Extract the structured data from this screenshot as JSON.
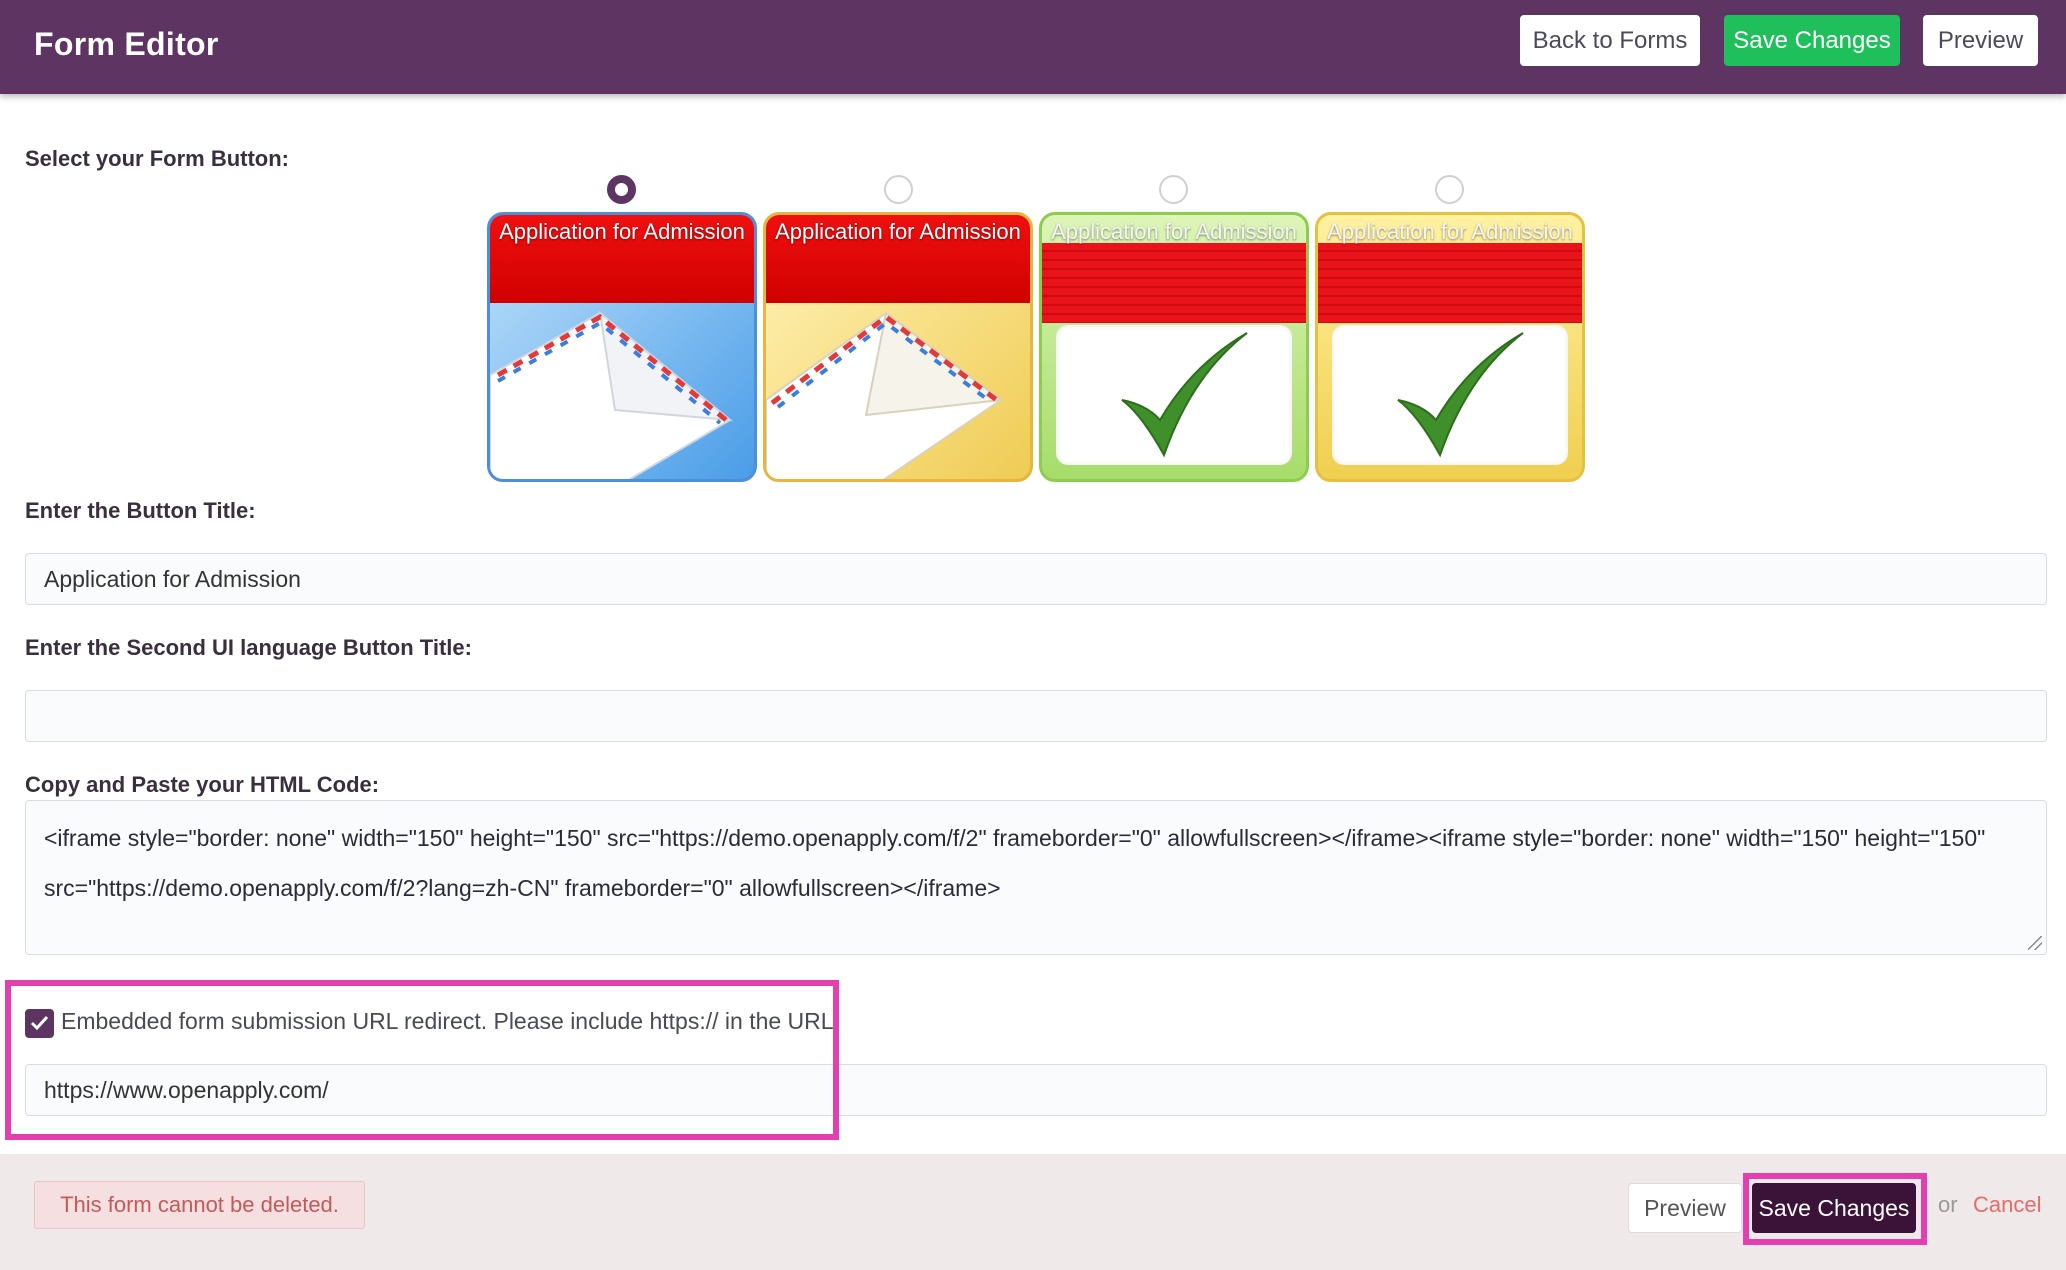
{
  "header": {
    "title": "Form Editor",
    "back_button": "Back to Forms",
    "save_button": "Save Changes",
    "preview_button": "Preview",
    "colors": {
      "bar": "#5e3463",
      "save": "#1fbf5c"
    }
  },
  "form_button": {
    "label": "Select your Form Button:",
    "selected_index": 0,
    "options": [
      {
        "title": "Application for Admission",
        "style": "blue envelope"
      },
      {
        "title": "Application for Admission",
        "style": "yellow envelope"
      },
      {
        "title": "Application for Admission",
        "style": "green checkmark"
      },
      {
        "title": "Application for Admission",
        "style": "gold checkmark"
      }
    ]
  },
  "button_title": {
    "label": "Enter the Button Title:",
    "value": "Application for Admission"
  },
  "second_title": {
    "label": "Enter the Second UI language Button Title:",
    "value": ""
  },
  "html_code": {
    "label": "Copy and Paste your HTML Code:",
    "value": "<iframe style=\"border: none\" width=\"150\" height=\"150\" src=\"https://demo.openapply.com/f/2\" frameborder=\"0\" allowfullscreen></iframe><iframe style=\"border: none\" width=\"150\" height=\"150\" src=\"https://demo.openapply.com/f/2?lang=zh-CN\" frameborder=\"0\" allowfullscreen></iframe>"
  },
  "redirect": {
    "checked": true,
    "label": "Embedded form submission URL redirect. Please include https:// in the URL.",
    "url": "https://www.openapply.com/"
  },
  "footer": {
    "alert": "This form cannot be deleted.",
    "preview_button": "Preview",
    "save_button": "Save Changes",
    "or_text": "or",
    "cancel_link": "Cancel"
  }
}
